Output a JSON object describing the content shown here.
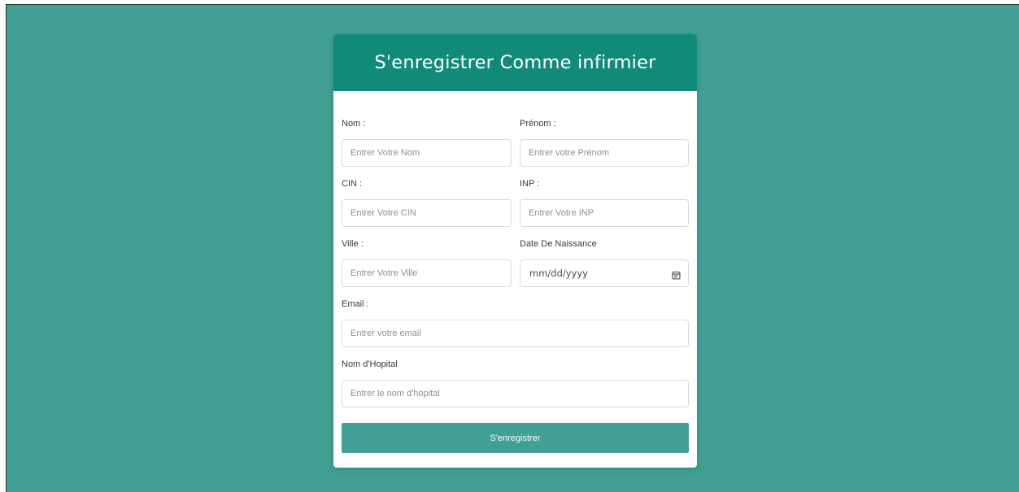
{
  "form": {
    "title": "S'enregistrer Comme infirmier",
    "fields": {
      "nom": {
        "label": "Nom :",
        "placeholder": "Entrer Votre Nom"
      },
      "prenom": {
        "label": "Prénom :",
        "placeholder": "Entrer votre Prénom"
      },
      "cin": {
        "label": "CIN :",
        "placeholder": "Entrer Votre CIN"
      },
      "inp": {
        "label": "INP :",
        "placeholder": "Entrer Votre INP"
      },
      "ville": {
        "label": "Ville :",
        "placeholder": "Entrer Votre Ville"
      },
      "date_naissance": {
        "label": "Date De Naissance",
        "placeholder": "mm/dd/yyyy",
        "icon": "calendar-icon"
      },
      "email": {
        "label": "Email :",
        "placeholder": "Entrer votre email"
      },
      "hopital": {
        "label": "Nom d'Hopital",
        "placeholder": "Entrer le nom d'hopital"
      }
    },
    "submit_label": "S'enregistrer"
  },
  "colors": {
    "background": "#419f93",
    "header": "#128a7a",
    "button": "#419f93"
  }
}
